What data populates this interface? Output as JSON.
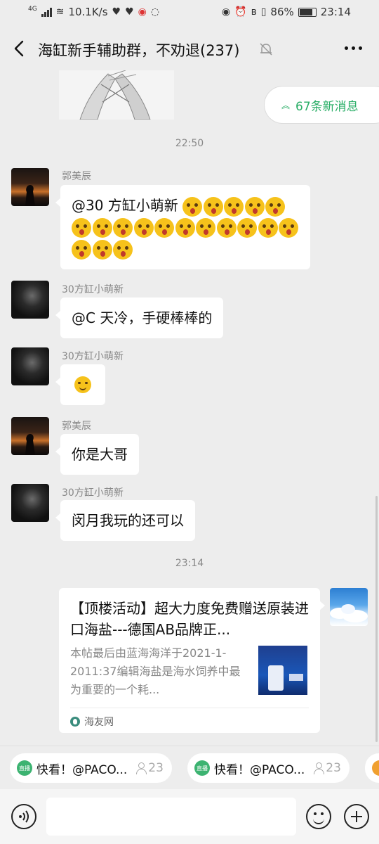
{
  "status": {
    "network": "4G",
    "speed": "10.1K/s",
    "battery": "86%",
    "time": "23:14"
  },
  "header": {
    "title": "海缸新手辅助群，不劝退(237)"
  },
  "new_messages": "67条新消息",
  "messages": [
    {
      "type": "time",
      "text": "22:50"
    },
    {
      "type": "text",
      "sender": "郭美辰",
      "avatar": "sunset",
      "text": "@30 方缸小萌新",
      "emoji_count": 19
    },
    {
      "type": "text",
      "sender": "30方缸小萌新",
      "avatar": "dark",
      "text": "@C  天冷，手硬棒棒的"
    },
    {
      "type": "emoji",
      "sender": "30方缸小萌新",
      "avatar": "dark"
    },
    {
      "type": "text",
      "sender": "郭美辰",
      "avatar": "sunset",
      "text": "你是大哥"
    },
    {
      "type": "text",
      "sender": "30方缸小萌新",
      "avatar": "dark",
      "text": "闵月我玩的还可以"
    },
    {
      "type": "time",
      "text": "23:14"
    }
  ],
  "link_card": {
    "title": "【顶楼活动】超大力度免费赠送原装进口海盐---德国AB品牌正...",
    "description": "本帖最后由蓝海海洋于2021-1-2011:37编辑海盐是海水饲养中最为重要的一个耗...",
    "source": "海友网"
  },
  "quick_bar": {
    "chips": [
      {
        "icon": "直播",
        "label": "快看！@PACO...",
        "count": "23"
      },
      {
        "icon": "直播",
        "label": "快看！@PACO...",
        "count": "23"
      }
    ]
  },
  "input": {
    "placeholder": ""
  },
  "colors": {
    "accent_green": "#2aae67",
    "background": "#ededed",
    "bubble": "#ffffff"
  }
}
